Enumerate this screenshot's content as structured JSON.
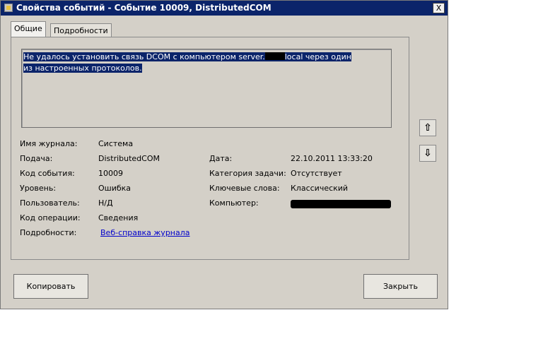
{
  "window": {
    "title": "Свойства событий - Событие 10009, DistributedCOM",
    "close_glyph": "X"
  },
  "tabs": [
    {
      "label": "Общие",
      "active": true
    },
    {
      "label": "Подробности",
      "active": false
    }
  ],
  "message": {
    "part1": "Не удалось установить связь DCOM с компьютером server.",
    "part2": "local через один из настроенных протоколов."
  },
  "fields_left": [
    {
      "label": "Имя журнала:",
      "value": "Система"
    },
    {
      "label": "Подача:",
      "value": "DistributedCOM"
    },
    {
      "label": "Код события:",
      "value": "10009"
    },
    {
      "label": "Уровень:",
      "value": "Ошибка"
    },
    {
      "label": "Пользователь:",
      "value": "Н/Д"
    },
    {
      "label": "Код операции:",
      "value": "Сведения"
    },
    {
      "label": "Подробности:",
      "value": "Веб-справка журнала"
    }
  ],
  "fields_right": [
    {
      "label": "Дата:",
      "value": "22.10.2011 13:33:20"
    },
    {
      "label": "Категория задачи:",
      "value": "Отсутствует"
    },
    {
      "label": "Ключевые слова:",
      "value": "Классический"
    },
    {
      "label": "Компьютер:",
      "value": ""
    }
  ],
  "nav": {
    "up_glyph": "⇧",
    "down_glyph": "⇩"
  },
  "buttons": {
    "copy": "Копировать",
    "close": "Закрыть"
  },
  "colors": {
    "title_bg": "#0b246a",
    "dialog_bg": "#d4d0c8",
    "link": "#0000cc"
  }
}
